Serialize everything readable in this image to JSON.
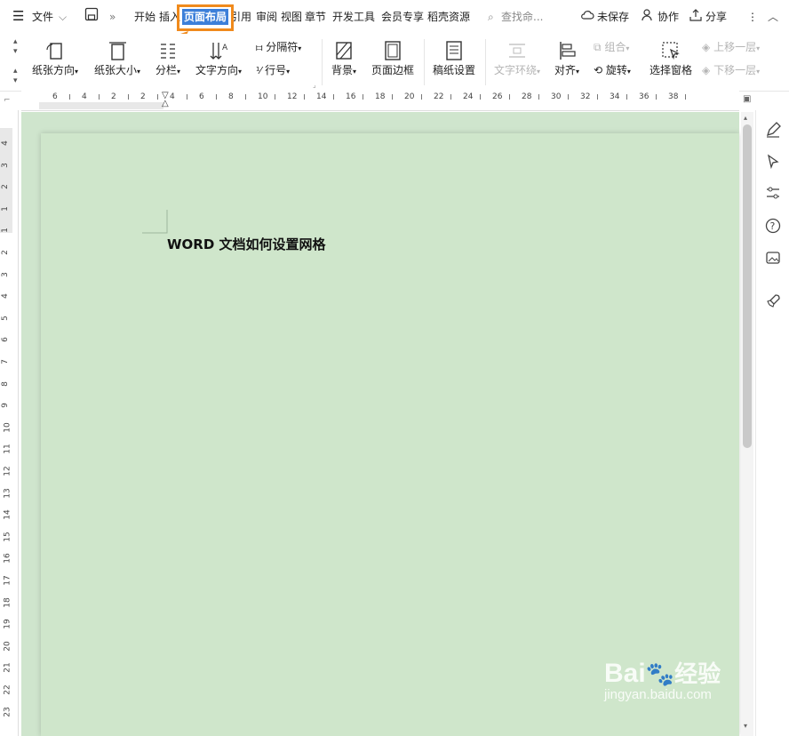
{
  "menubar": {
    "file_label": "文件",
    "tabs": [
      "开始",
      "插入",
      "页面布局",
      "引用",
      "审阅",
      "视图",
      "章节",
      "开发工具",
      "会员专享",
      "稻壳资源"
    ],
    "active_tab": "页面布局",
    "search_placeholder": "查找命...",
    "unsaved_label": "未保存",
    "collab_label": "协作",
    "share_label": "分享"
  },
  "ribbon": {
    "orientation": "纸张方向",
    "size": "纸张大小",
    "columns": "分栏",
    "text_direction": "文字方向",
    "separator": "分隔符",
    "line_numbers": "行号",
    "background": "背景",
    "page_border": "页面边框",
    "grid_paper": "稿纸设置",
    "text_wrap": "文字环绕",
    "align": "对齐",
    "group": "组合",
    "rotate": "旋转",
    "selection_pane": "选择窗格",
    "bring_forward": "上移一层",
    "send_backward": "下移一层"
  },
  "ruler": {
    "horizontal": [
      "6",
      "4",
      "2",
      "2",
      "4",
      "6",
      "8",
      "10",
      "12",
      "14",
      "16",
      "18",
      "20",
      "22",
      "24",
      "26",
      "28",
      "30",
      "32",
      "34",
      "36",
      "38"
    ],
    "vertical": [
      "4",
      "3",
      "2",
      "1",
      "1",
      "2",
      "3",
      "4",
      "5",
      "6",
      "7",
      "8",
      "9",
      "10",
      "11",
      "12",
      "13",
      "14",
      "15",
      "16",
      "17",
      "18",
      "19",
      "20",
      "21",
      "22",
      "23"
    ]
  },
  "document": {
    "title": "WORD 文档如何设置网格"
  },
  "watermark": {
    "brand": "Bai",
    "brand2": "经验",
    "url": "jingyan.baidu.com"
  },
  "colors": {
    "accent": "#3c7fd9",
    "highlight": "#f08a1c",
    "page": "#cfe6cb"
  }
}
